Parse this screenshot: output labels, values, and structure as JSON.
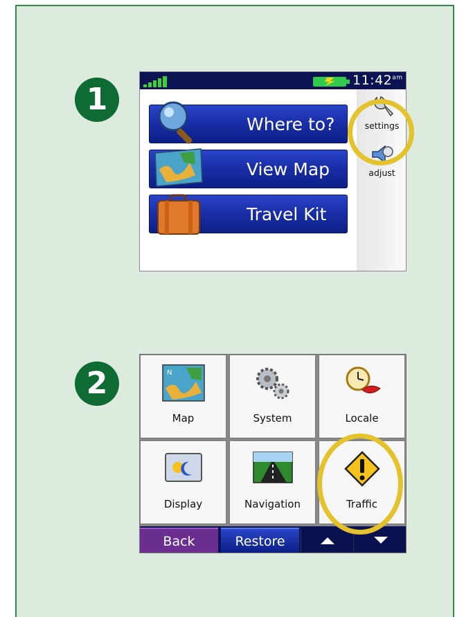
{
  "step1": {
    "number": "1"
  },
  "step2": {
    "number": "2"
  },
  "main_menu": {
    "status": {
      "time": "11:42",
      "ampm": "am"
    },
    "buttons": [
      {
        "label": "Where to?",
        "icon": "magnifier-icon"
      },
      {
        "label": "View Map",
        "icon": "map-icon"
      },
      {
        "label": "Travel Kit",
        "icon": "suitcase-icon"
      }
    ],
    "side": [
      {
        "label": "settings",
        "icon": "wrench-icon"
      },
      {
        "label": "adjust",
        "icon": "speaker-icon"
      }
    ]
  },
  "settings_menu": {
    "items": [
      {
        "label": "Map",
        "icon": "map-icon"
      },
      {
        "label": "System",
        "icon": "gears-icon"
      },
      {
        "label": "Locale",
        "icon": "clock-lips-icon"
      },
      {
        "label": "Display",
        "icon": "display-icon"
      },
      {
        "label": "Navigation",
        "icon": "road-icon"
      },
      {
        "label": "Traffic",
        "icon": "warning-icon"
      }
    ],
    "bottom": {
      "back_label": "Back",
      "restore_label": "Restore"
    }
  },
  "colors": {
    "panel_bg": "#dcebdd",
    "panel_border": "#2e8a4a",
    "step_badge": "#0d6b33",
    "highlight_ring": "#e3c22c",
    "button_blue": "#1a2fa8",
    "back_purple": "#6a2d90"
  }
}
